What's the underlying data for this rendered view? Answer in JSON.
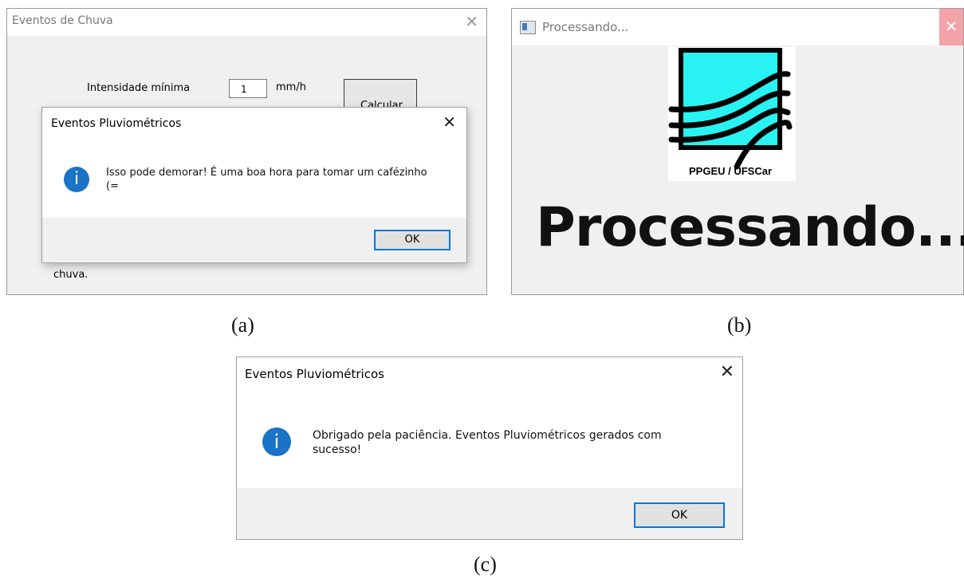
{
  "panel_a": {
    "window_title": "Eventos de Chuva",
    "close_glyph": "✕",
    "intensity_label": "Intensidade mínima",
    "intensity_value": "1",
    "intensity_unit": "mm/h",
    "calculate_label": "Calcular",
    "bottom_text": "chuva.",
    "dialog": {
      "title": "Eventos Pluviométricos",
      "close_glyph": "✕",
      "icon": "info-icon",
      "message_line1": "Isso pode demorar! É uma boa hora para tomar um cafézinho",
      "message_line2": "(=",
      "ok_label": "OK"
    }
  },
  "panel_b": {
    "window_title": "Processando...",
    "close_glyph": "✕",
    "logo_caption": "PPGEU / UFSCar",
    "big_text": "Processando...",
    "logo_color": "#28f2f2"
  },
  "panel_c": {
    "dialog": {
      "title": "Eventos Pluviométricos",
      "close_glyph": "✕",
      "icon": "info-icon",
      "message_line1": "Obrigado pela paciência. Eventos Pluviométricos gerados com",
      "message_line2": "sucesso!",
      "ok_label": "OK"
    }
  },
  "captions": {
    "a": "(a)",
    "b": "(b)",
    "c": "(c)"
  },
  "colors": {
    "accent": "#0078d7",
    "info_icon": "#1a73c7",
    "dialog_footer": "#f0f0f0"
  }
}
